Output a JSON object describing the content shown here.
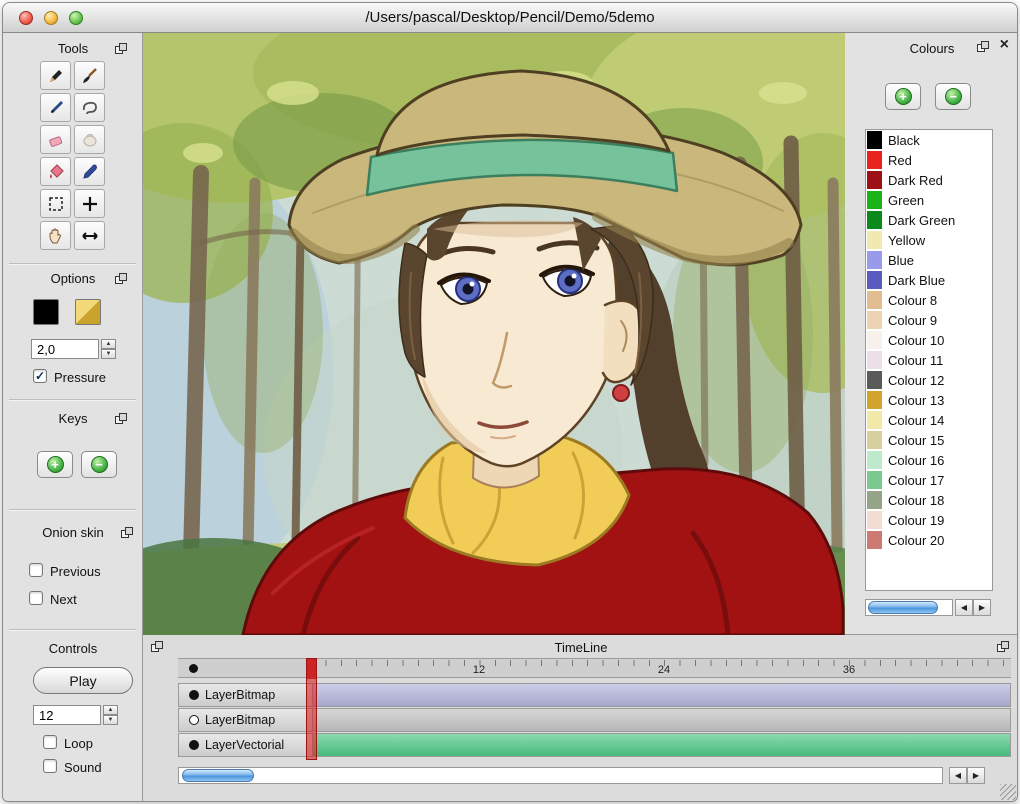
{
  "window": {
    "title": "/Users/pascal/Desktop/Pencil/Demo/5demo"
  },
  "sidebar": {
    "tools": {
      "title": "Tools",
      "items": [
        "pencil",
        "brush",
        "pen",
        "polyline",
        "eraser",
        "smudge",
        "bucket",
        "eyedropper",
        "select",
        "move",
        "hand",
        "flip-horizontal"
      ]
    },
    "options": {
      "title": "Options",
      "stroke_width": "2,0",
      "stroke_colour": "#000000",
      "fill_colour": "#d9b84a",
      "pressure": {
        "label": "Pressure",
        "checked": true
      }
    },
    "keys": {
      "title": "Keys"
    },
    "onion_skin": {
      "title": "Onion skin",
      "previous": {
        "label": "Previous",
        "checked": false
      },
      "next": {
        "label": "Next",
        "checked": false
      }
    },
    "controls": {
      "title": "Controls",
      "play_label": "Play",
      "fps": "12",
      "loop": {
        "label": "Loop",
        "checked": false
      },
      "sound": {
        "label": "Sound",
        "checked": false
      }
    }
  },
  "colours_panel": {
    "title": "Colours",
    "colours": [
      {
        "name": "Black",
        "hex": "#000000"
      },
      {
        "name": "Red",
        "hex": "#e8241c"
      },
      {
        "name": "Dark Red",
        "hex": "#9c1016"
      },
      {
        "name": "Green",
        "hex": "#18b418"
      },
      {
        "name": "Dark Green",
        "hex": "#0a8a1a"
      },
      {
        "name": "Yellow",
        "hex": "#f0eab0"
      },
      {
        "name": "Blue",
        "hex": "#9a9aec"
      },
      {
        "name": "Dark Blue",
        "hex": "#5a5ac0"
      },
      {
        "name": "Colour 8",
        "hex": "#e2bd92"
      },
      {
        "name": "Colour 9",
        "hex": "#ecd3b2"
      },
      {
        "name": "Colour 10",
        "hex": "#f8f0ea"
      },
      {
        "name": "Colour 11",
        "hex": "#ecdfe7"
      },
      {
        "name": "Colour 12",
        "hex": "#5a5a5a"
      },
      {
        "name": "Colour 13",
        "hex": "#d2a42c"
      },
      {
        "name": "Colour 14",
        "hex": "#f2e9a8"
      },
      {
        "name": "Colour 15",
        "hex": "#d6cf9e"
      },
      {
        "name": "Colour 16",
        "hex": "#bfe9cc"
      },
      {
        "name": "Colour 17",
        "hex": "#7cc98f"
      },
      {
        "name": "Colour 18",
        "hex": "#95a388"
      },
      {
        "name": "Colour 19",
        "hex": "#f2dcd4"
      },
      {
        "name": "Colour 20",
        "hex": "#cc7a72"
      }
    ]
  },
  "timeline": {
    "title": "TimeLine",
    "current_frame": 1,
    "ruler_labels": [
      "12",
      "24",
      "36"
    ],
    "layers": [
      {
        "name": "LayerBitmap",
        "visible": true,
        "track_color": "#b2b2da"
      },
      {
        "name": "LayerBitmap",
        "visible": false,
        "track_color": "#c2c2c2"
      },
      {
        "name": "LayerVectorial",
        "visible": true,
        "track_color": "#4cc584"
      }
    ]
  }
}
